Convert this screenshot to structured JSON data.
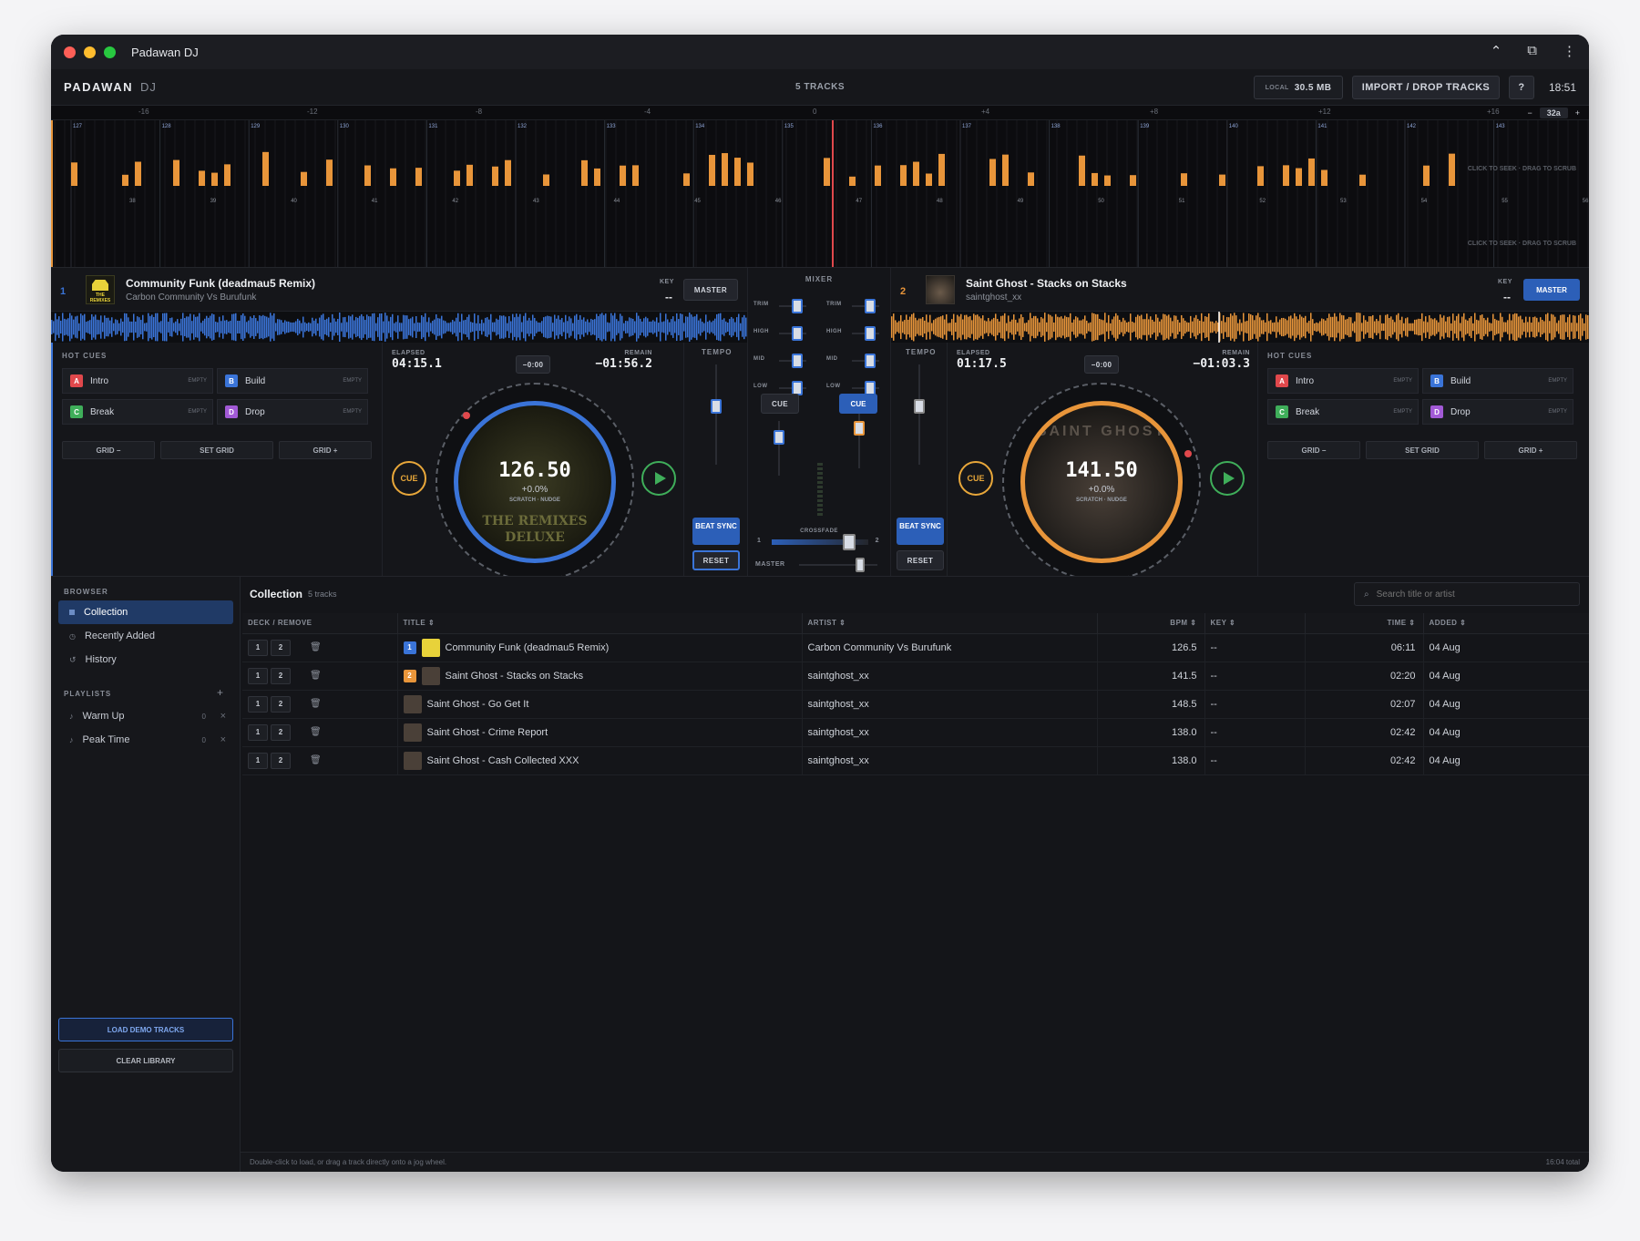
{
  "window": {
    "title": "Padawan DJ",
    "clock": "18:51"
  },
  "topbar": {
    "brand": "PADAWAN",
    "brand_sub": "DJ",
    "track_count": "5 TRACKS",
    "local_label": "LOCAL",
    "local_size": "30.5 MB",
    "import_label": "IMPORT / DROP TRACKS",
    "help_label": "?"
  },
  "overview": {
    "ruler_labels": [
      "-16",
      "-12",
      "-8",
      "-4",
      "0",
      "+4",
      "+8",
      "+12",
      "+16"
    ],
    "zoom_minus": "−",
    "zoom_value": "32a",
    "zoom_plus": "+",
    "bar_top": [
      "127",
      "128",
      "129",
      "130",
      "131",
      "132",
      "133",
      "134",
      "135",
      "136",
      "137",
      "138",
      "139",
      "140",
      "141",
      "142",
      "143"
    ],
    "bar_bottom": [
      "38",
      "39",
      "40",
      "41",
      "42",
      "43",
      "44",
      "45",
      "46",
      "47",
      "48",
      "49",
      "50",
      "51",
      "52",
      "53",
      "54",
      "55",
      "56"
    ],
    "hint": "CLICK TO SEEK · DRAG TO SCRUB"
  },
  "deck1": {
    "number": "1",
    "title": "Community Funk (deadmau5 Remix)",
    "artist": "Carbon Community Vs Burufunk",
    "key_label": "KEY",
    "key_value": "--",
    "master_label": "MASTER",
    "elapsed_label": "ELAPSED",
    "elapsed": "04:15.1",
    "offset": "−0:00",
    "remain_label": "REMAIN",
    "remain": "−01:56.2",
    "bpm": "126.50",
    "pitch": "+0.0%",
    "jog_hint": "SCRATCH · NUDGE",
    "cue_label": "CUE",
    "tempo_label": "TEMPO",
    "beat_sync": "BEAT SYNC",
    "reset": "RESET",
    "accent": "#3a74d8",
    "art_text": "THE REMIXES DELUXE",
    "thumb_text": "THE REMIXES DELUXE"
  },
  "deck2": {
    "number": "2",
    "title": "Saint Ghost - Stacks on Stacks",
    "artist": "saintghost_xx",
    "key_label": "KEY",
    "key_value": "--",
    "master_label": "MASTER",
    "elapsed_label": "ELAPSED",
    "elapsed": "01:17.5",
    "offset": "−0:00",
    "remain_label": "REMAIN",
    "remain": "−01:03.3",
    "bpm": "141.50",
    "pitch": "+0.0%",
    "jog_hint": "SCRATCH · NUDGE",
    "cue_label": "CUE",
    "tempo_label": "TEMPO",
    "beat_sync": "BEAT SYNC",
    "reset": "RESET",
    "accent": "#e8953a",
    "art_text": "SAINT GHOST",
    "thumb_text": "SAINT GHOST"
  },
  "hot_cues": {
    "label": "HOT CUES",
    "empty": "EMPTY",
    "cues": [
      {
        "letter": "A",
        "name": "Intro",
        "color": "#e0484c"
      },
      {
        "letter": "B",
        "name": "Build",
        "color": "#3a74d8"
      },
      {
        "letter": "C",
        "name": "Break",
        "color": "#3fae5a"
      },
      {
        "letter": "D",
        "name": "Drop",
        "color": "#a25ad6"
      }
    ],
    "grid_minus": "GRID −",
    "set_grid": "SET GRID",
    "grid_plus": "GRID +"
  },
  "mixer": {
    "label": "MIXER",
    "trim": "TRIM",
    "high": "HIGH",
    "mid": "MID",
    "low": "LOW",
    "cue": "CUE",
    "crossfade": "CROSSFADE",
    "cf_left": "1",
    "cf_right": "2",
    "master": "MASTER",
    "crossfade_position": 0.85,
    "master_level": 0.78
  },
  "browser": {
    "label": "BROWSER",
    "items": [
      "Collection",
      "Recently Added",
      "History"
    ],
    "playlists_label": "PLAYLISTS",
    "add": "+",
    "playlists": [
      {
        "name": "Warm Up",
        "count": "0"
      },
      {
        "name": "Peak Time",
        "count": "0"
      }
    ],
    "remove_icon": "×",
    "load_demo": "LOAD DEMO TRACKS",
    "clear_library": "CLEAR LIBRARY"
  },
  "collection": {
    "title": "Collection",
    "count": "5 tracks",
    "search_placeholder": "Search title or artist",
    "columns": [
      "DECK / REMOVE",
      "TITLE ⇕",
      "ARTIST ⇕",
      "BPM ⇕",
      "KEY ⇕",
      "TIME ⇕",
      "ADDED ⇕"
    ],
    "deck_btn_1": "1",
    "deck_btn_2": "2",
    "trash_icon": "🗑",
    "rows": [
      {
        "badge": "1",
        "badge_color": "#3a74d8",
        "title": "Community Funk (deadmau5 Remix)",
        "artist": "Carbon Community Vs Burufunk",
        "bpm": "126.5",
        "key": "--",
        "time": "06:11",
        "added": "04 Aug"
      },
      {
        "badge": "2",
        "badge_color": "#e8953a",
        "title": "Saint Ghost - Stacks on Stacks",
        "artist": "saintghost_xx",
        "bpm": "141.5",
        "key": "--",
        "time": "02:20",
        "added": "04 Aug"
      },
      {
        "badge": "",
        "badge_color": "",
        "title": "Saint Ghost - Go Get It",
        "artist": "saintghost_xx",
        "bpm": "148.5",
        "key": "--",
        "time": "02:07",
        "added": "04 Aug"
      },
      {
        "badge": "",
        "badge_color": "",
        "title": "Saint Ghost - Crime Report",
        "artist": "saintghost_xx",
        "bpm": "138.0",
        "key": "--",
        "time": "02:42",
        "added": "04 Aug"
      },
      {
        "badge": "",
        "badge_color": "",
        "title": "Saint Ghost - Cash Collected XXX",
        "artist": "saintghost_xx",
        "bpm": "138.0",
        "key": "--",
        "time": "02:42",
        "added": "04 Aug"
      }
    ],
    "footer_hint": "Double-click to load, or drag a track directly onto a jog wheel.",
    "footer_total": "16:04 total"
  }
}
